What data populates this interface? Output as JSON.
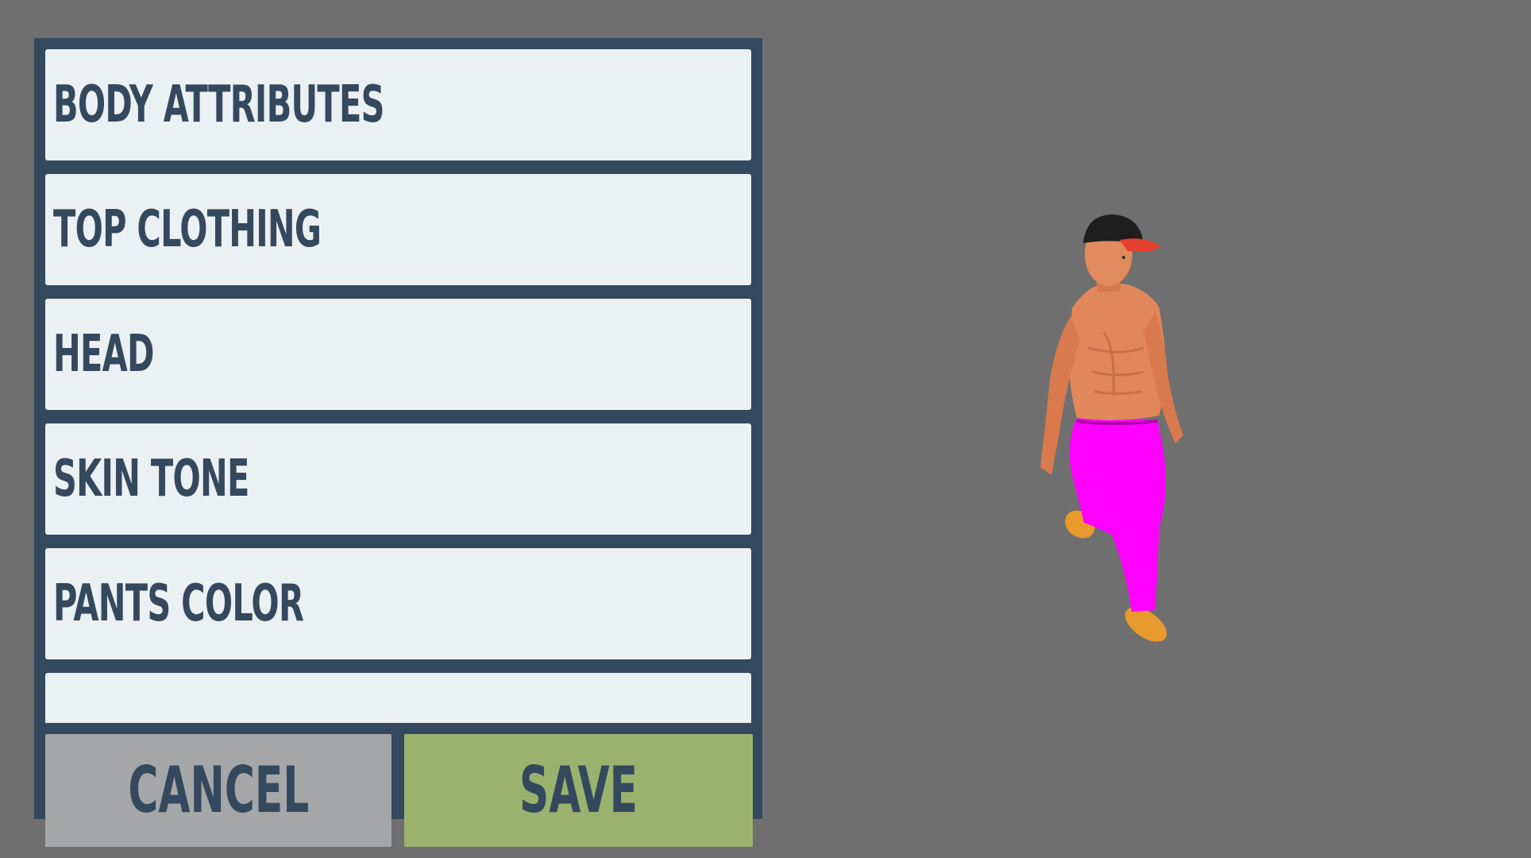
{
  "menu": {
    "items": [
      {
        "label": "BODY ATTRIBUTES"
      },
      {
        "label": "TOP CLOTHING"
      },
      {
        "label": "HEAD"
      },
      {
        "label": "SKIN TONE"
      },
      {
        "label": "PANTS COLOR"
      },
      {
        "label": ""
      }
    ]
  },
  "buttons": {
    "cancel_label": "CANCEL",
    "save_label": "SAVE"
  },
  "colors": {
    "background": "#6f6f6f",
    "panel": "#34495e",
    "item": "#ebf0f2",
    "cancel": "#a5a6a7",
    "save": "#99b36e",
    "pants": "#ff00ff",
    "shoes": "#e89a2c",
    "cap": "#1e1e1e",
    "cap_brim": "#e3402f",
    "skin": "#e2875a"
  },
  "character": {
    "icon": "character-preview"
  }
}
